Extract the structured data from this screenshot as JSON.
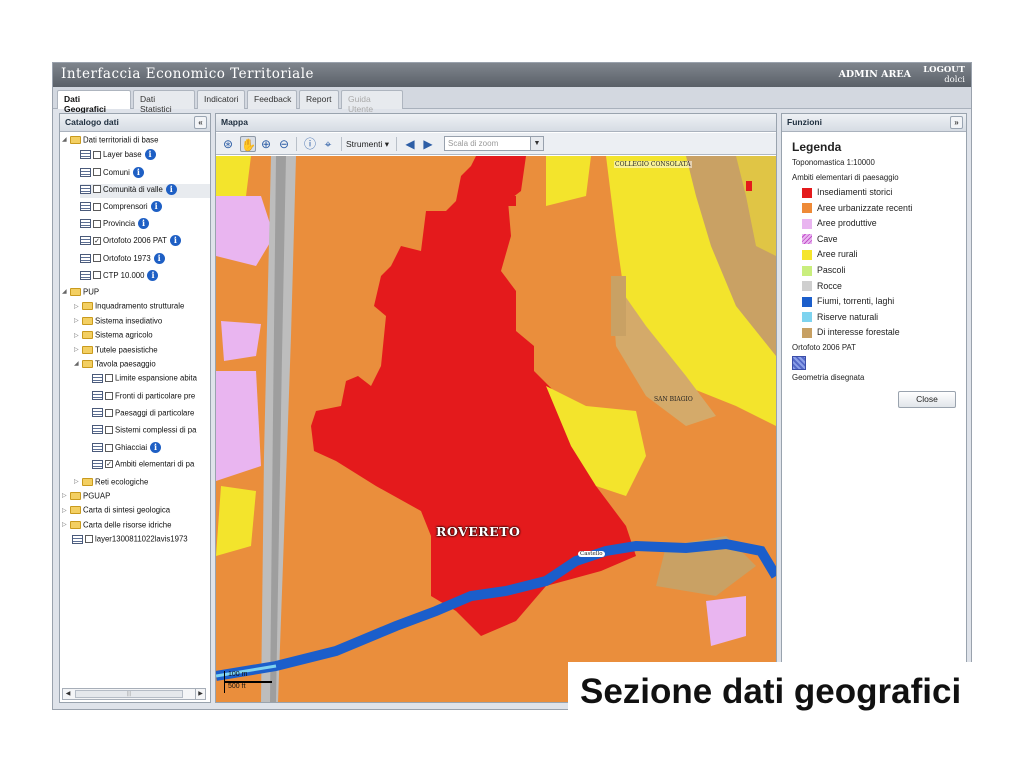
{
  "app": {
    "title": "Interfaccia Economico Territoriale",
    "admin_area": "ADMIN AREA",
    "logout_label": "LOGOUT",
    "user": "dolci"
  },
  "tabs": [
    {
      "label": "Dati Geografici",
      "active": true
    },
    {
      "label": "Dati Statistici"
    },
    {
      "label": "Indicatori"
    },
    {
      "label": "Feedback"
    },
    {
      "label": "Report"
    },
    {
      "label": "Guida Utente",
      "disabled": true
    }
  ],
  "catalog": {
    "title": "Catalogo dati",
    "collapse_icon": "«",
    "tree": [
      {
        "label": "Dati territoriali di base",
        "type": "folder",
        "expanded": true
      },
      {
        "label": "Layer base",
        "type": "layer",
        "checked": false,
        "info": true
      },
      {
        "label": "Comuni",
        "type": "layer",
        "checked": false,
        "info": true
      },
      {
        "label": "Comunità di valle",
        "type": "layer",
        "checked": false,
        "info": true,
        "highlight": true
      },
      {
        "label": "Comprensori",
        "type": "layer",
        "checked": false,
        "info": true
      },
      {
        "label": "Provincia",
        "type": "layer",
        "checked": false,
        "info": true
      },
      {
        "label": "Ortofoto 2006 PAT",
        "type": "layer",
        "checked": true,
        "info": true
      },
      {
        "label": "Ortofoto 1973",
        "type": "layer",
        "checked": false,
        "info": true
      },
      {
        "label": "CTP 10.000",
        "type": "layer",
        "checked": false,
        "info": true
      },
      {
        "label": "PUP",
        "type": "folder",
        "expanded": true
      },
      {
        "label": "Inquadramento strutturale",
        "type": "folder"
      },
      {
        "label": "Sistema insediativo",
        "type": "folder"
      },
      {
        "label": "Sistema agricolo",
        "type": "folder"
      },
      {
        "label": "Tutele paesistiche",
        "type": "folder"
      },
      {
        "label": "Tavola paesaggio",
        "type": "folder",
        "expanded": true
      },
      {
        "label": "Limite espansione abita",
        "type": "layer",
        "checked": false
      },
      {
        "label": "Fronti di particolare pre",
        "type": "layer",
        "checked": false
      },
      {
        "label": "Paesaggi di particolare",
        "type": "layer",
        "checked": false
      },
      {
        "label": "Sistemi complessi di pa",
        "type": "layer",
        "checked": false
      },
      {
        "label": "Ghiacciai",
        "type": "layer",
        "checked": false,
        "info": true
      },
      {
        "label": "Ambiti elementari di pa",
        "type": "layer",
        "checked": true
      },
      {
        "label": "Reti ecologiche",
        "type": "folder"
      },
      {
        "label": "PGUAP",
        "type": "folder"
      },
      {
        "label": "Carta di sintesi geologica",
        "type": "folder"
      },
      {
        "label": "Carta delle risorse idriche",
        "type": "folder"
      },
      {
        "label": "layer1300811022lavis1973",
        "type": "layer",
        "checked": false
      }
    ]
  },
  "map": {
    "title": "Mappa",
    "tools_label": "Strumenti",
    "zoom_placeholder": "Scala di zoom",
    "labels": {
      "city": "ROVERETO",
      "college": "COLLEGIO CONSOLATA",
      "san_biagio": "SAN BIAGIO",
      "castello": "Castello"
    },
    "scale_m": "100 m",
    "scale_ft": "500 ft"
  },
  "funzioni": {
    "title": "Funzioni",
    "collapse_icon": "»",
    "legend_title": "Legenda",
    "toponomastica": "Toponomastica 1:10000",
    "ambiti_title": "Ambiti elementari di paesaggio",
    "legend_items": [
      {
        "label": "Insediamenti storici",
        "color": "#e41a1c"
      },
      {
        "label": "Aree urbanizzate recenti",
        "color": "#ee8a37"
      },
      {
        "label": "Aree produttive",
        "color": "#e9b5f0"
      },
      {
        "label": "Cave",
        "color": "#e9b5f0",
        "pattern": "hatch"
      },
      {
        "label": "Aree rurali",
        "color": "#f5e52c"
      },
      {
        "label": "Pascoli",
        "color": "#c9ee7d"
      },
      {
        "label": "Rocce",
        "color": "#cfcfcf"
      },
      {
        "label": "Fiumi, torrenti, laghi",
        "color": "#1b5ecb"
      },
      {
        "label": "Riserve naturali",
        "color": "#7ed3ef"
      },
      {
        "label": "Di interesse forestale",
        "color": "#c7a063"
      }
    ],
    "ortofoto_label": "Ortofoto 2006 PAT",
    "geometria_label": "Geometria disegnata",
    "close_label": "Close"
  },
  "caption": "Sezione dati geografici"
}
